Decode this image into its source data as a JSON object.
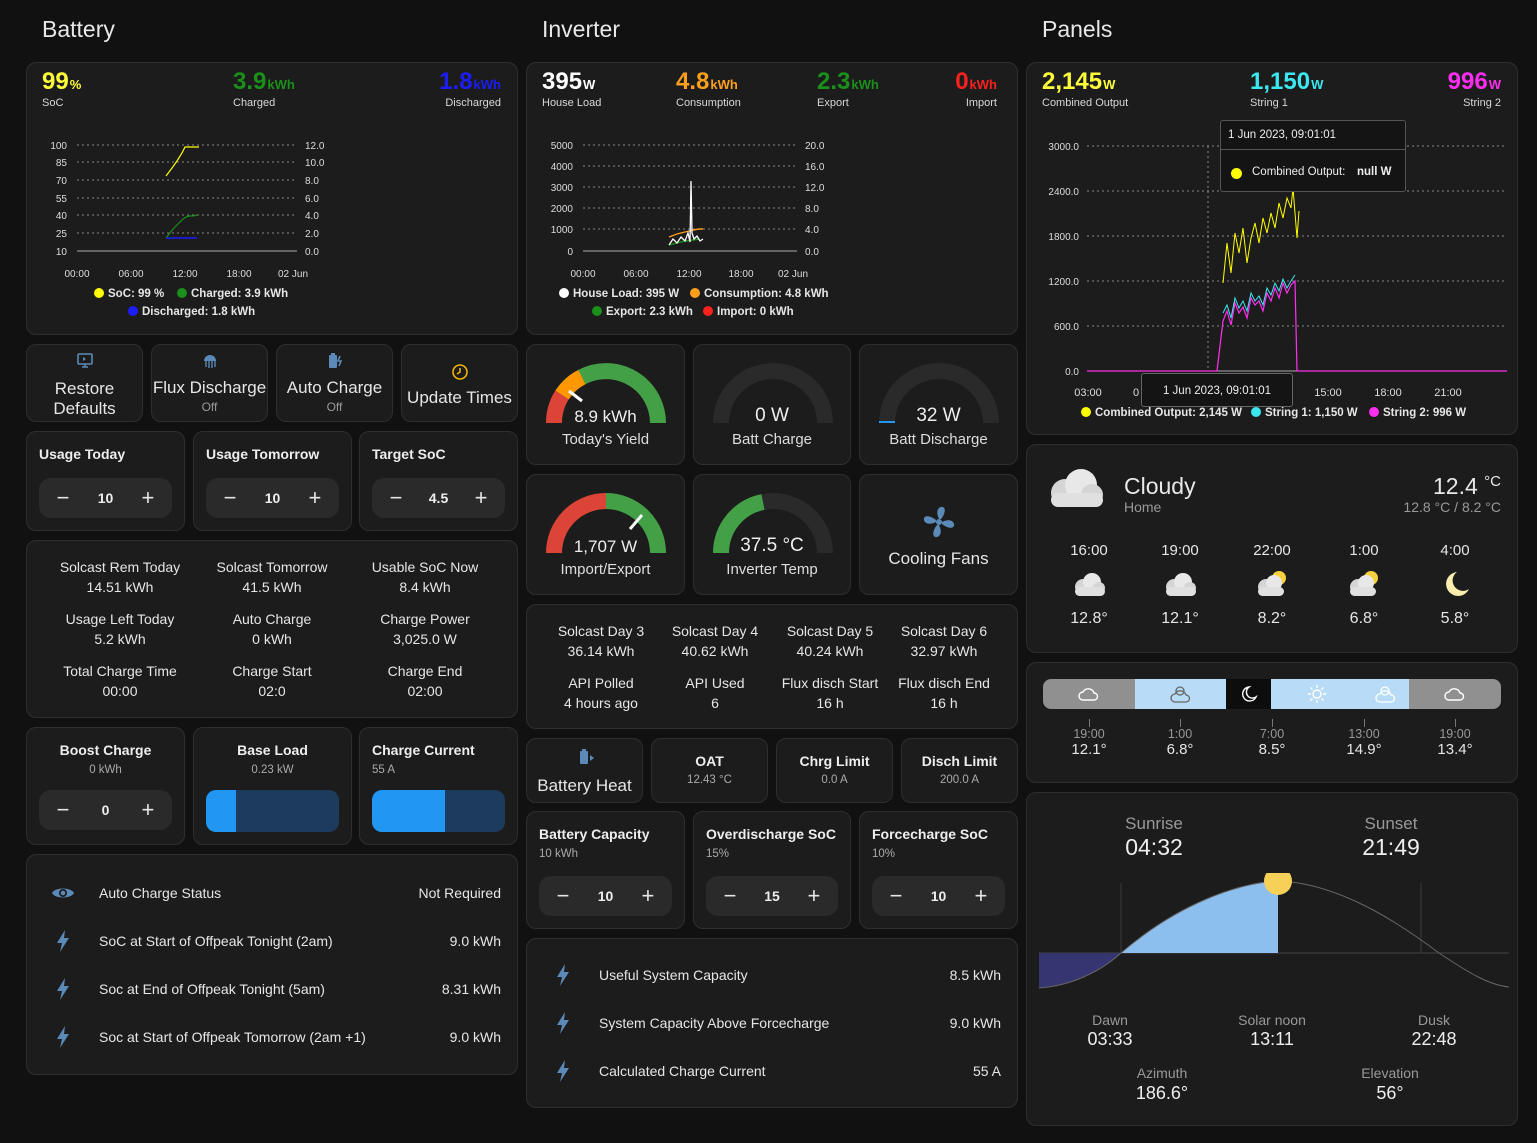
{
  "columns": {
    "battery": "Battery",
    "inverter": "Inverter",
    "panels": "Panels"
  },
  "battery_stats": [
    {
      "value": "99",
      "unit": "%",
      "label": "SoC",
      "color": "#ffff3b"
    },
    {
      "value": "3.9",
      "unit": "kWh",
      "label": "Charged",
      "color": "#1a8f1a"
    },
    {
      "value": "1.8",
      "unit": "kWh",
      "label": "Discharged",
      "color": "#1c1cff"
    }
  ],
  "battery_chart": {
    "left_ticks": [
      "100",
      "85",
      "70",
      "55",
      "40",
      "25",
      "10"
    ],
    "right_ticks": [
      "12.0",
      "10.0",
      "8.0",
      "6.0",
      "4.0",
      "2.0",
      "0.0"
    ],
    "x_ticks": [
      "00:00",
      "06:00",
      "12:00",
      "18:00",
      "02 Jun"
    ],
    "legend": [
      {
        "label": "SoC: 99 %",
        "color": "#ffff00"
      },
      {
        "label": "Charged: 3.9 kWh",
        "color": "#1a8f1a"
      },
      {
        "label": "Discharged: 1.8 kWh",
        "color": "#1c1cff"
      }
    ]
  },
  "inverter_stats": [
    {
      "value": "395",
      "unit": "W",
      "label": "House Load",
      "color": "#ffffff"
    },
    {
      "value": "4.8",
      "unit": "kWh",
      "label": "Consumption",
      "color": "#ff9f1c"
    },
    {
      "value": "2.3",
      "unit": "kWh",
      "label": "Export",
      "color": "#1a8f1a"
    },
    {
      "value": "0",
      "unit": "kWh",
      "label": "Import",
      "color": "#ff2020"
    }
  ],
  "inverter_chart": {
    "left_ticks": [
      "5000",
      "4000",
      "3000",
      "2000",
      "1000",
      "0"
    ],
    "right_ticks": [
      "20.0",
      "16.0",
      "12.0",
      "8.0",
      "4.0",
      "0.0"
    ],
    "x_ticks": [
      "00:00",
      "06:00",
      "12:00",
      "18:00",
      "02 Jun"
    ],
    "legend": [
      {
        "label": "House Load: 395 W",
        "color": "#ffffff"
      },
      {
        "label": "Consumption: 4.8 kWh",
        "color": "#ff9f1c"
      },
      {
        "label": "Export: 2.3 kWh",
        "color": "#1a8f1a"
      },
      {
        "label": "Import: 0 kWh",
        "color": "#ff2020"
      }
    ]
  },
  "panels_stats": [
    {
      "value": "2,145",
      "unit": "W",
      "label": "Combined Output",
      "color": "#ffff3b"
    },
    {
      "value": "1,150",
      "unit": "W",
      "label": "String 1",
      "color": "#3be8f0"
    },
    {
      "value": "996",
      "unit": "W",
      "label": "String 2",
      "color": "#ff2ef0"
    }
  ],
  "panels_chart": {
    "left_ticks": [
      "3000.0",
      "2400.0",
      "1800.0",
      "1200.0",
      "600.0",
      "0.0"
    ],
    "x_ticks": [
      "03:00",
      "0",
      "15:00",
      "18:00",
      "21:00"
    ],
    "tooltip_title": "1 Jun 2023, 09:01:01",
    "tooltip_series": "Combined Output:",
    "tooltip_value": "null W",
    "cursor_label": "1 Jun 2023, 09:01:01",
    "legend": [
      {
        "label": "Combined Output: 2,145 W",
        "color": "#ffff00"
      },
      {
        "label": "String 1: 1,150 W",
        "color": "#3be8f0"
      },
      {
        "label": "String 2: 996 W",
        "color": "#ff2ef0"
      }
    ]
  },
  "buttons": [
    {
      "label": "Restore Defaults",
      "sub": "",
      "icon": "restore-icon"
    },
    {
      "label": "Flux Discharge",
      "sub": "Off",
      "icon": "jellyfish-icon"
    },
    {
      "label": "Auto Charge",
      "sub": "Off",
      "icon": "battery-charging-icon"
    },
    {
      "label": "Update Times",
      "sub": "",
      "icon": "clock-icon"
    }
  ],
  "numbers_row1": [
    {
      "title": "Usage Today",
      "value": "10"
    },
    {
      "title": "Usage Tomorrow",
      "value": "10"
    },
    {
      "title": "Target SoC",
      "value": "4.5"
    }
  ],
  "info_grid": [
    {
      "name": "Solcast Rem Today",
      "value": "14.51 kWh"
    },
    {
      "name": "Solcast Tomorrow",
      "value": "41.5 kWh"
    },
    {
      "name": "Usable SoC Now",
      "value": "8.4 kWh"
    },
    {
      "name": "Usage Left Today",
      "value": "5.2 kWh"
    },
    {
      "name": "Auto Charge",
      "value": "0 kWh"
    },
    {
      "name": "Charge Power",
      "value": "3,025.0 W"
    },
    {
      "name": "Total Charge Time",
      "value": "00:00"
    },
    {
      "name": "Charge Start",
      "value": "02:0"
    },
    {
      "name": "Charge End",
      "value": "02:00"
    }
  ],
  "boost": {
    "title": "Boost Charge",
    "sub": "0 kWh",
    "value": "0"
  },
  "base_load": {
    "title": "Base Load",
    "sub": "0.23 kW",
    "level": 0.23
  },
  "charge_current": {
    "title": "Charge Current",
    "sub": "55 A",
    "level": 0.55
  },
  "battery_entities": [
    {
      "name": "Auto Charge Status",
      "value": "Not Required",
      "icon": "eye-icon"
    },
    {
      "name": "SoC at Start of Offpeak Tonight (2am)",
      "value": "9.0 kWh",
      "icon": "flash-icon"
    },
    {
      "name": "Soc at End of Offpeak Tonight (5am)",
      "value": "8.31 kWh",
      "icon": "flash-icon"
    },
    {
      "name": "Soc at Start of Offpeak Tomorrow (2am +1)",
      "value": "9.0 kWh",
      "icon": "flash-icon"
    }
  ],
  "gauges": [
    {
      "value": "8.9 kWh",
      "label": "Today's Yield",
      "level": 0.89
    },
    {
      "value": "0 W",
      "label": "Batt Charge",
      "level": 0.0
    },
    {
      "value": "32 W",
      "label": "Batt Discharge",
      "level": 0.03
    },
    {
      "value": "1,707 W",
      "label": "Import/Export",
      "level": 0.72
    },
    {
      "value": "37.5 °C",
      "label": "Inverter Temp",
      "level": 0.45
    }
  ],
  "cooling": {
    "label": "Cooling Fans"
  },
  "solcast_grid": [
    {
      "name": "Solcast Day 3",
      "value": "36.14 kWh"
    },
    {
      "name": "Solcast Day 4",
      "value": "40.62 kWh"
    },
    {
      "name": "Solcast Day 5",
      "value": "40.24 kWh"
    },
    {
      "name": "Solcast Day 6",
      "value": "32.97 kWh"
    },
    {
      "name": "API Polled",
      "value": "4 hours ago"
    },
    {
      "name": "API Used",
      "value": "6"
    },
    {
      "name": "Flux disch Start",
      "value": "16 h"
    },
    {
      "name": "Flux disch End",
      "value": "16 h"
    }
  ],
  "battery_heat": {
    "label": "Battery Heat"
  },
  "small_info": [
    {
      "title": "OAT",
      "value": "12.43 °C"
    },
    {
      "title": "Chrg Limit",
      "value": "0.0 A"
    },
    {
      "title": "Disch Limit",
      "value": "200.0 A"
    }
  ],
  "numbers_row2": [
    {
      "title": "Battery Capacity",
      "sub": "10 kWh",
      "value": "10"
    },
    {
      "title": "Overdischarge SoC",
      "sub": "15%",
      "value": "15"
    },
    {
      "title": "Forcecharge SoC",
      "sub": "10%",
      "value": "10"
    }
  ],
  "inverter_entities": [
    {
      "name": "Useful System Capacity",
      "value": "8.5 kWh",
      "icon": "flash-icon"
    },
    {
      "name": "System Capacity Above Forcecharge",
      "value": "9.0 kWh",
      "icon": "flash-icon"
    },
    {
      "name": "Calculated Charge Current",
      "value": "55 A",
      "icon": "flash-icon"
    }
  ],
  "weather": {
    "condition": "Cloudy",
    "location": "Home",
    "temp": "12.4",
    "temp_unit": "°C",
    "hi_lo": "12.8 °C / 8.2 °C",
    "forecast": [
      {
        "time": "16:00",
        "temp": "12.8°",
        "icon": "cloudy-icon"
      },
      {
        "time": "19:00",
        "temp": "12.1°",
        "icon": "cloudy-icon"
      },
      {
        "time": "22:00",
        "temp": "8.2°",
        "icon": "partly-cloudy-icon"
      },
      {
        "time": "1:00",
        "temp": "6.8°",
        "icon": "partly-cloudy-icon"
      },
      {
        "time": "4:00",
        "temp": "5.8°",
        "icon": "moon-icon"
      }
    ]
  },
  "timeline": {
    "ticks": [
      {
        "time": "19:00",
        "temp": "12.1°"
      },
      {
        "time": "1:00",
        "temp": "6.8°"
      },
      {
        "time": "7:00",
        "temp": "8.5°"
      },
      {
        "time": "13:00",
        "temp": "14.9°"
      },
      {
        "time": "19:00",
        "temp": "13.4°"
      }
    ]
  },
  "sun": {
    "sunrise_label": "Sunrise",
    "sunrise": "04:32",
    "sunset_label": "Sunset",
    "sunset": "21:49",
    "dawn_label": "Dawn",
    "dawn": "03:33",
    "noon_label": "Solar noon",
    "noon": "13:11",
    "dusk_label": "Dusk",
    "dusk": "22:48",
    "azimuth_label": "Azimuth",
    "azimuth": "186.6°",
    "elevation_label": "Elevation",
    "elevation": "56°"
  }
}
